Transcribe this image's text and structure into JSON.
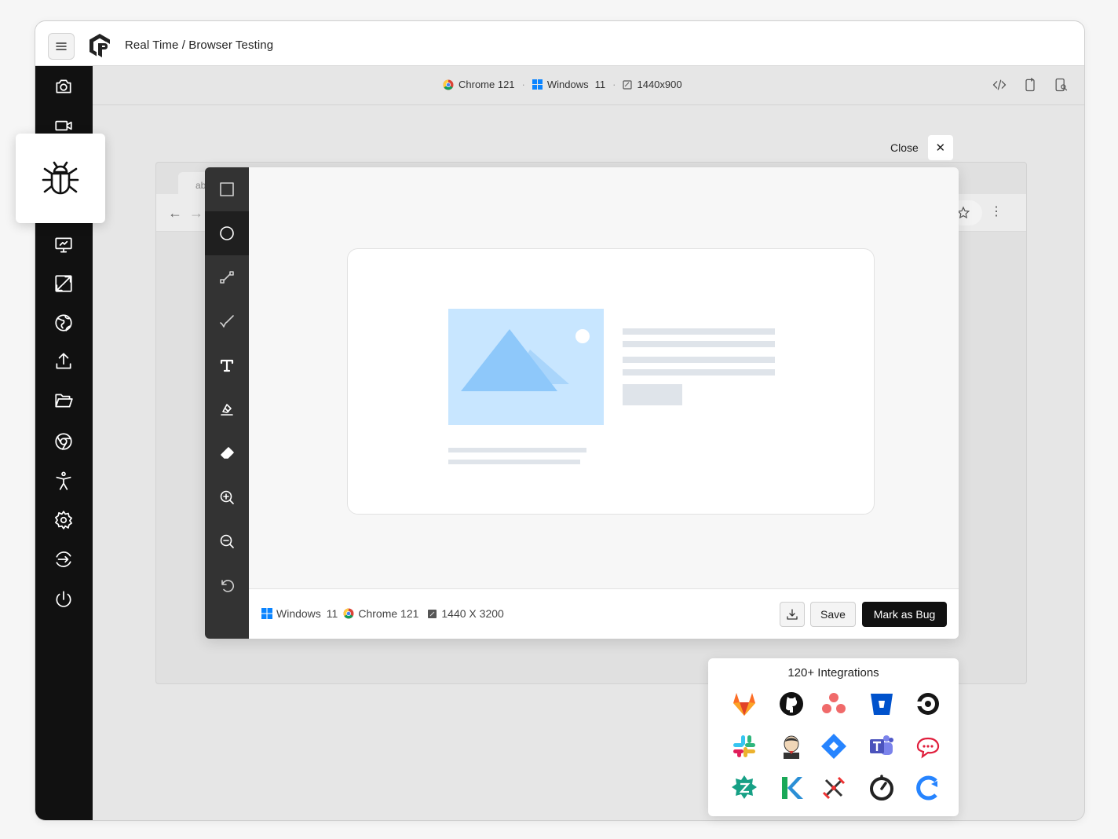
{
  "app": {
    "title": "Real Time / Browser Testing",
    "logo": "lambdatest-logo-icon"
  },
  "sidebar": {
    "items": [
      {
        "icon": "camera-icon"
      },
      {
        "icon": "video-icon"
      },
      {
        "icon": "bug-icon",
        "active": true
      },
      {
        "icon": "monitor-icon"
      },
      {
        "icon": "resize-icon"
      },
      {
        "icon": "globe-icon"
      },
      {
        "icon": "upload-icon"
      },
      {
        "icon": "folder-icon"
      },
      {
        "icon": "chrome-icon"
      },
      {
        "icon": "accessibility-icon"
      },
      {
        "icon": "settings-icon"
      },
      {
        "icon": "switch-icon"
      },
      {
        "icon": "power-icon"
      }
    ]
  },
  "session_bar": {
    "browser": "Chrome 121",
    "os": "Windows",
    "os_version": "11",
    "resolution": "1440x900",
    "right_tools": [
      "code-icon",
      "device-rotate-icon",
      "device-settings-icon"
    ]
  },
  "background_browser": {
    "tab_text": "ab"
  },
  "close": {
    "label": "Close",
    "icon": "close-icon"
  },
  "editor": {
    "tools": [
      {
        "name": "rectangle",
        "icon": "square-icon"
      },
      {
        "name": "ellipse",
        "icon": "circle-icon",
        "active": true
      },
      {
        "name": "arrow",
        "icon": "arrow-icon"
      },
      {
        "name": "pen",
        "icon": "pen-icon"
      },
      {
        "name": "text",
        "icon": "text-icon"
      },
      {
        "name": "highlight",
        "icon": "highlighter-icon"
      },
      {
        "name": "eraser",
        "icon": "eraser-icon"
      },
      {
        "name": "zoom-in",
        "icon": "zoom-in-icon"
      },
      {
        "name": "zoom-out",
        "icon": "zoom-out-icon"
      },
      {
        "name": "undo",
        "icon": "undo-icon"
      }
    ],
    "footer": {
      "os": "Windows",
      "os_version": "11",
      "browser": "Chrome 121",
      "resolution": "1440 X 3200",
      "download_icon": "download-icon",
      "save_label": "Save",
      "mark_bug_label": "Mark as Bug"
    }
  },
  "integrations": {
    "title": "120+ Integrations",
    "icons": [
      "gitlab-icon",
      "github-icon",
      "asana-icon",
      "bitbucket-icon",
      "circleci-icon",
      "slack-icon",
      "jenkins-icon",
      "jira-icon",
      "teams-icon",
      "rocketchat-icon",
      "zenhub-icon",
      "kanbanize-icon",
      "bugherd-icon",
      "teamwork-icon",
      "clickup-icon"
    ]
  },
  "colors": {
    "sidebar_bg": "#111111",
    "toolbar_bg": "#333333",
    "primary_button": "#111111",
    "placeholder_image": "#c8e6ff",
    "placeholder_lines": "#dfe4ea"
  }
}
